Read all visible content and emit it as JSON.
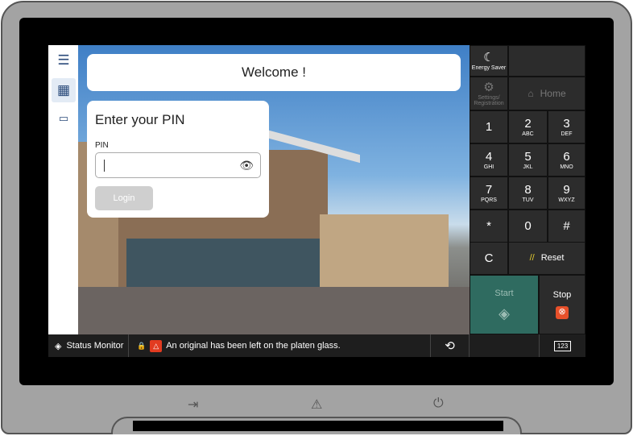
{
  "welcome": "Welcome !",
  "pin_dialog": {
    "title": "Enter your PIN",
    "field_label": "PIN",
    "value": "",
    "login_label": "Login"
  },
  "sidebar": {
    "items": [
      {
        "icon": "menu-icon"
      },
      {
        "icon": "dashboard-icon"
      },
      {
        "icon": "card-login-icon"
      }
    ]
  },
  "panel": {
    "energy_saver": "Energy Saver",
    "settings": "Settings/ Registration",
    "home": "Home",
    "keys": [
      {
        "main": "1",
        "sub": ""
      },
      {
        "main": "2",
        "sub": "ABC"
      },
      {
        "main": "3",
        "sub": "DEF"
      },
      {
        "main": "4",
        "sub": "GHI"
      },
      {
        "main": "5",
        "sub": "JKL"
      },
      {
        "main": "6",
        "sub": "MNO"
      },
      {
        "main": "7",
        "sub": "PQRS"
      },
      {
        "main": "8",
        "sub": "TUV"
      },
      {
        "main": "9",
        "sub": "WXYZ"
      },
      {
        "main": "*",
        "sub": ""
      },
      {
        "main": "0",
        "sub": ""
      },
      {
        "main": "#",
        "sub": ""
      }
    ],
    "clear": "C",
    "reset": "Reset",
    "start": "Start",
    "stop": "Stop"
  },
  "status_bar": {
    "status_monitor": "Status Monitor",
    "message": "An original has been left on the platen glass.",
    "keyboard": "123"
  },
  "colors": {
    "start": "#2f6b60",
    "stop": "#e8502a",
    "warning": "#e23b20"
  }
}
